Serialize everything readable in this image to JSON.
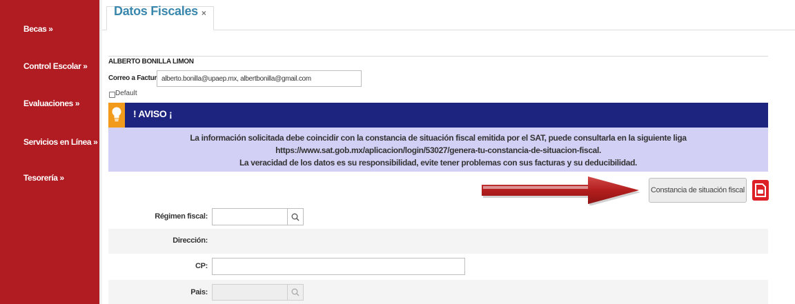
{
  "sidebar": {
    "items": [
      {
        "label": "Becas »"
      },
      {
        "label": "Control Escolar »"
      },
      {
        "label": "Evaluaciones »"
      },
      {
        "label": "Servicios en Línea »"
      },
      {
        "label": "Tesorería »"
      }
    ]
  },
  "tab": {
    "title": "Datos Fiscales",
    "close": "×"
  },
  "user": {
    "name": "ALBERTO BONILLA LIMON",
    "email_label": "Correo a Facturar:",
    "email_value": "alberto.bonilla@upaep.mx, albertbonilla@gmail.com",
    "default_label": "Default"
  },
  "aviso": {
    "title": "! AVISO ¡",
    "line1": "La información solicitada debe coincidir con la constancia de situación fiscal emitida por el SAT, puede consultarla en la siguiente liga",
    "line2": "https://www.sat.gob.mx/aplicacion/login/53027/genera-tu-constancia-de-situacion-fiscal.",
    "line3": "La veracidad de los datos es su responsibilidad, evite tener problemas con sus facturas y su deducibilidad."
  },
  "buttons": {
    "constancia": "Constancia de situación fiscal"
  },
  "form": {
    "regimen_label": "Régimen fiscal:",
    "direccion_label": "Dirección:",
    "cp_label": "CP:",
    "pais_label": "Pais:"
  },
  "colors": {
    "sidebar": "#b01c22",
    "aviso_bar": "#1d2480",
    "aviso_body": "#d2d0f5",
    "accent": "#f19a1c",
    "tab_title": "#3a87ad"
  }
}
